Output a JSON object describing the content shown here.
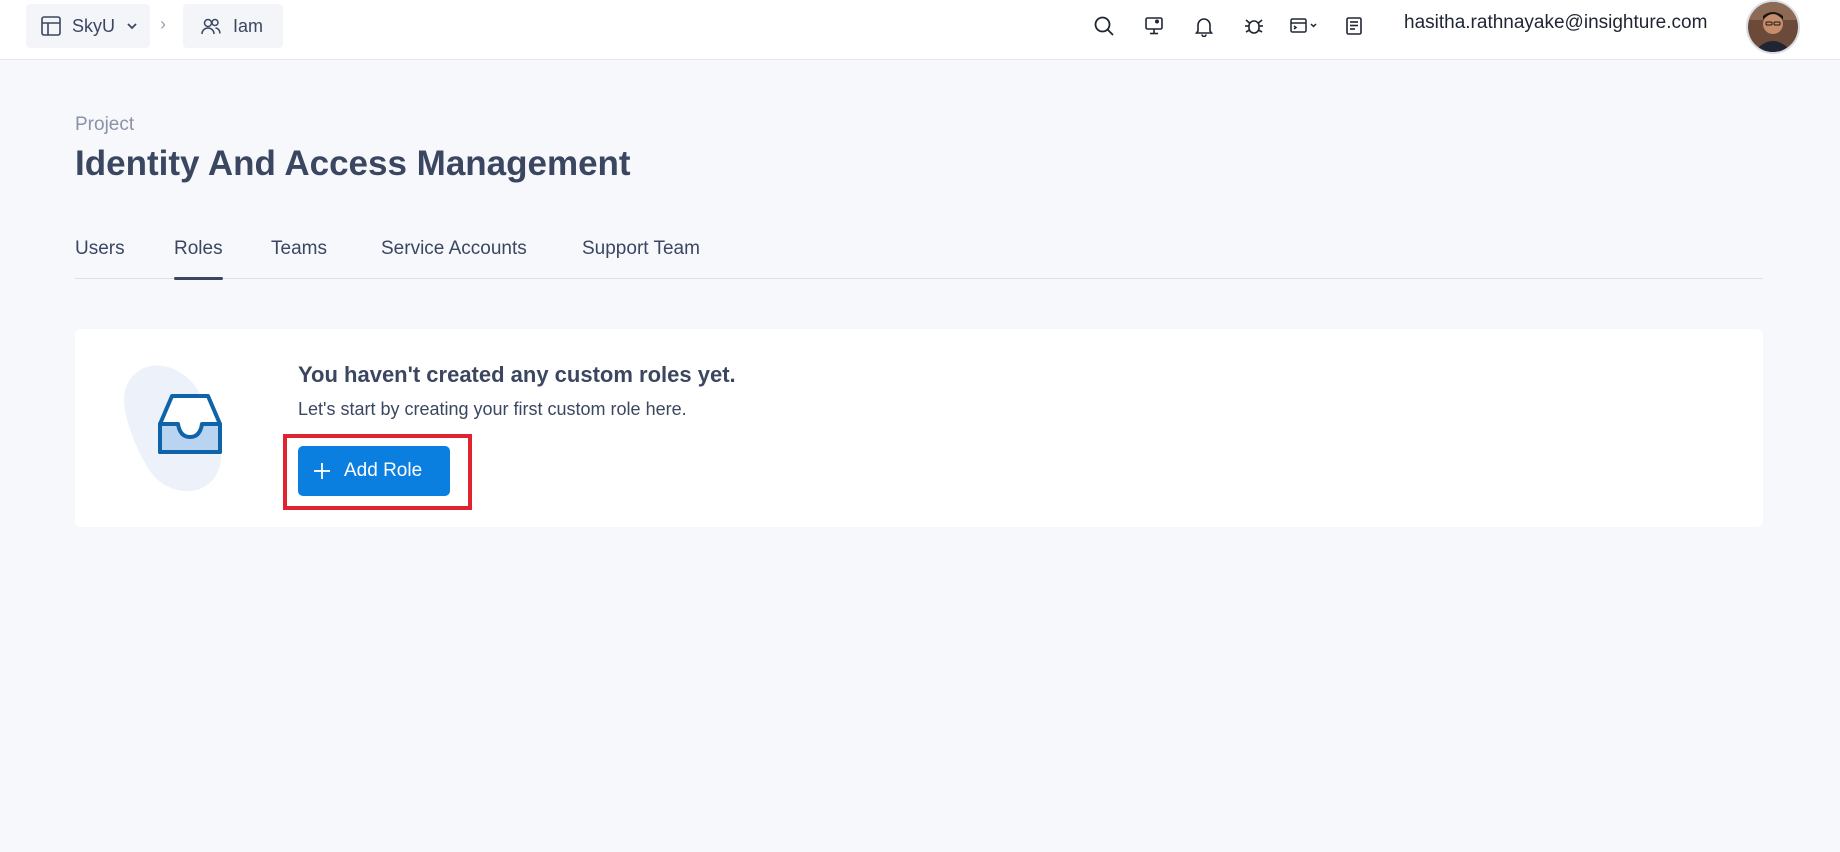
{
  "header": {
    "breadcrumbs": [
      {
        "label": "SkyU",
        "icon": "layout-grid-icon"
      },
      {
        "label": "Iam",
        "icon": "users-icon"
      }
    ],
    "separator": "›",
    "icons": [
      "search-icon",
      "monitor-icon",
      "bell-icon",
      "bug-icon",
      "terminal-icon",
      "notes-icon"
    ],
    "user_email": "hasitha.rathnayake@insighture.com"
  },
  "page": {
    "kicker": "Project",
    "title": "Identity And Access Management"
  },
  "tabs": [
    {
      "label": "Users",
      "active": false
    },
    {
      "label": "Roles",
      "active": true
    },
    {
      "label": "Teams",
      "active": false
    },
    {
      "label": "Service Accounts",
      "active": false
    },
    {
      "label": "Support Team",
      "active": false
    }
  ],
  "empty_state": {
    "title": "You haven't created any custom roles yet.",
    "subtitle": "Let's start by creating your first custom role here.",
    "button_label": "Add Role",
    "icon": "inbox-icon"
  },
  "colors": {
    "primary": "#0b7fe0",
    "highlight": "#e0242f",
    "text": "#3b4660",
    "background": "#f6f8fc"
  }
}
